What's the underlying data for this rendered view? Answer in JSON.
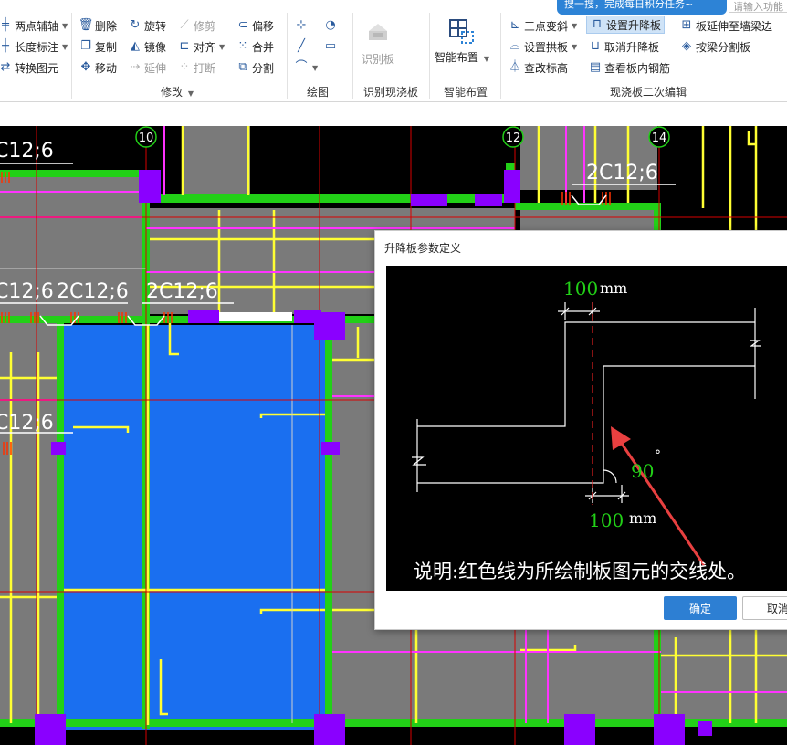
{
  "search": {
    "tip": "搜一搜，完成每日积分任务~",
    "placeholder": "请输入功能"
  },
  "ribbon": {
    "axis": {
      "two_point_axis": "两点辅轴",
      "length_mark": "长度标注",
      "convert_element": "转换图元"
    },
    "modify": {
      "label": "修改",
      "delete": "删除",
      "rotate": "旋转",
      "trim": "修剪",
      "offset": "偏移",
      "copy": "复制",
      "mirror": "镜像",
      "align": "对齐",
      "merge": "合并",
      "move": "移动",
      "extend": "延伸",
      "break": "打断",
      "split": "分割"
    },
    "draw": {
      "label": "绘图"
    },
    "identify": {
      "label": "识别现浇板",
      "button": "识别板"
    },
    "smart": {
      "label": "智能布置",
      "button": "智能布置"
    },
    "secondary": {
      "label": "现浇板二次编辑",
      "three_point_slope": "三点变斜",
      "set_raised_slab": "设置升降板",
      "extend_to_wall_beam": "板延伸至墙梁边",
      "set_arch_slab": "设置拱板",
      "cancel_raised_slab": "取消升降板",
      "split_by_beam": "按梁分割板",
      "check_elevation": "查改标高",
      "view_slab_rebar": "查看板内钢筋"
    }
  },
  "cad": {
    "axis_labels": [
      "10",
      "12",
      "14"
    ],
    "rebar_labels": [
      "C12;6",
      "2C12;6",
      "C12;6",
      "2C12;6",
      "2C12;6",
      "C12;6"
    ]
  },
  "dialog": {
    "title": "升降板参数定义",
    "top_value": "100",
    "top_unit": "mm",
    "bottom_value": "100",
    "bottom_unit": "mm",
    "angle_value": "90",
    "angle_unit": "°",
    "note": "说明:红色线为所绘制板图元的交线处。",
    "ok": "确定",
    "cancel": "取消"
  },
  "colors": {
    "blue_selected": "#1a6ff0",
    "green_beam": "#22d017",
    "yellow_line": "#ffff33",
    "magenta_line": "#ff33ff",
    "purple_column": "#8a00ff",
    "red_axis": "#d90000",
    "gray_slab": "#7a7a7a",
    "ok_button": "#2d7fd3"
  }
}
